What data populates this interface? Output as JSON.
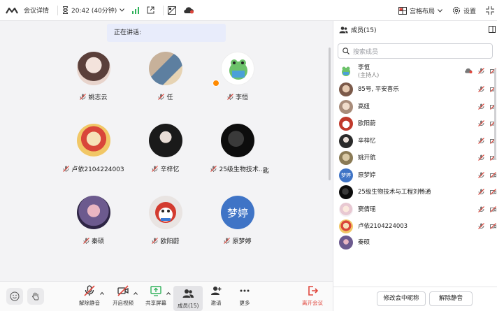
{
  "topbar": {
    "meeting_info": "会议详情",
    "time": "20:42 (40分钟)",
    "layout_label": "宫格布局",
    "settings_label": "设置"
  },
  "main": {
    "speaking_label": "正在讲话:",
    "participants": [
      {
        "name": "姚志云",
        "avatar_color": "#c9a9a0"
      },
      {
        "name": "任",
        "avatar_color": "#7a8fa8"
      },
      {
        "name": "李恒",
        "avatar_color": "#ffffff"
      },
      {
        "name": "卢依2104224003",
        "avatar_color": "#e8c36a"
      },
      {
        "name": "辛梓忆",
        "avatar_color": "#2a2a2a"
      },
      {
        "name": "25级生物技术...",
        "avatar_color": "#111111"
      },
      {
        "name": "秦硕",
        "avatar_color": "#6c5a8e"
      },
      {
        "name": "欧阳蔚",
        "avatar_color": "#d8d0cc"
      },
      {
        "name": "原梦婷",
        "avatar_color": "#3f74c6",
        "avatar_text": "梦婷"
      }
    ],
    "extra_tile_char": "匙"
  },
  "toolbar": {
    "unmute": "解除静音",
    "start_video": "开启视频",
    "share_screen": "共享屏幕",
    "members": "成员(15)",
    "invite": "邀请",
    "more": "更多",
    "leave": "离开会议"
  },
  "panel": {
    "title": "成员(15)",
    "search_placeholder": "搜索成员",
    "members": [
      {
        "name": "李恒",
        "sub": "(主持人)",
        "color": "#ffffff"
      },
      {
        "name": "85号, 平安喜乐",
        "color": "#7b5a4a"
      },
      {
        "name": "高妞",
        "color": "#a88c7a"
      },
      {
        "name": "欧阳蔚",
        "color": "#c0392b"
      },
      {
        "name": "辛梓忆",
        "color": "#2a2a2a"
      },
      {
        "name": "姚开航",
        "color": "#8a7a55"
      },
      {
        "name": "原梦婷",
        "color": "#3f74c6",
        "text": "梦婷"
      },
      {
        "name": "25级生物技术与工程刘畅通",
        "color": "#111111"
      },
      {
        "name": "窦倩瑶",
        "color": "#f0e6e8"
      },
      {
        "name": "卢依2104224003",
        "color": "#e8c36a"
      },
      {
        "name": "秦硕",
        "color": "#6c5a8e"
      }
    ],
    "rename_button": "修改会中昵称",
    "unmute_button": "解除静音"
  },
  "colors": {
    "accent": "#3f74c6",
    "mute_red": "#e0463c",
    "leave_red": "#e0463c",
    "signal_green": "#2fb15a"
  }
}
